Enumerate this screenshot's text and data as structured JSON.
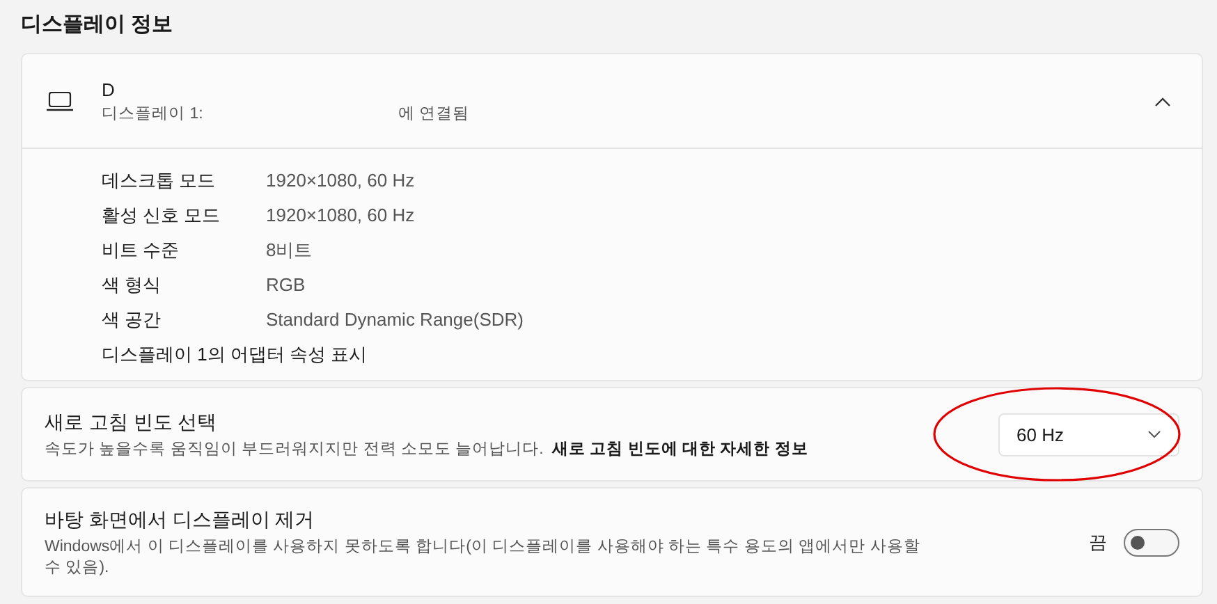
{
  "section_title": "디스플레이 정보",
  "display": {
    "name": "D",
    "subtitle_prefix": "디스플레이 1:",
    "subtitle_suffix": "에 연결됨",
    "expanded": true,
    "details": [
      {
        "label": "데스크톱 모드",
        "value": "1920×1080, 60 Hz"
      },
      {
        "label": "활성 신호 모드",
        "value": "1920×1080, 60 Hz"
      },
      {
        "label": "비트 수준",
        "value": "8비트"
      },
      {
        "label": "색 형식",
        "value": "RGB"
      },
      {
        "label": "색 공간",
        "value": "Standard Dynamic Range(SDR)"
      }
    ],
    "adapter_link": "디스플레이 1의 어댑터 속성 표시"
  },
  "refresh_rate": {
    "title": "새로 고침 빈도 선택",
    "description": "속도가 높을수록 움직임이 부드러워지지만 전력 소모도 늘어납니다.",
    "link": "새로 고침 빈도에 대한 자세한 정보",
    "value": "60 Hz"
  },
  "remove_display": {
    "title": "바탕 화면에서 디스플레이 제거",
    "description": "Windows에서 이 디스플레이를 사용하지 못하도록 합니다(이 디스플레이를 사용해야 하는 특수 용도의 앱에서만 사용할 수 있음).",
    "toggle_label": "끔",
    "on": false
  }
}
